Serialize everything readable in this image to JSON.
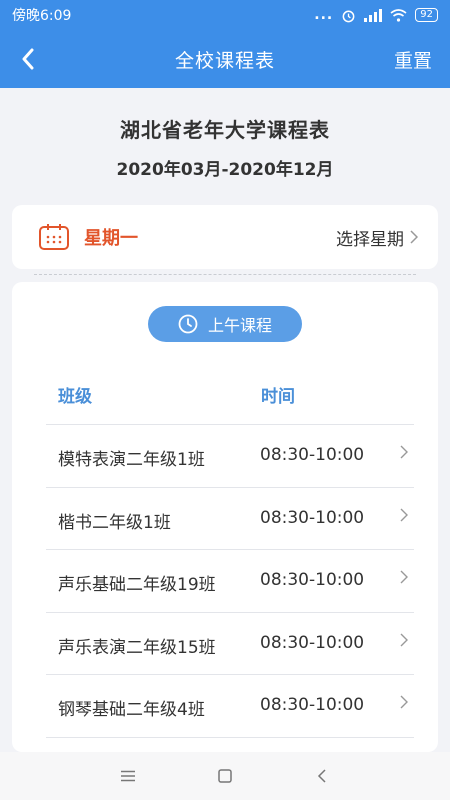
{
  "status_bar": {
    "time": "傍晚6:09",
    "dots": "...",
    "battery": "92"
  },
  "navbar": {
    "title": "全校课程表",
    "reset_label": "重置"
  },
  "header": {
    "school_title": "湖北省老年大学课程表",
    "term": "2020年03月-2020年12月"
  },
  "day_picker": {
    "current_day": "星期一",
    "select_label": "选择星期"
  },
  "session": {
    "label": "上午课程"
  },
  "table": {
    "headers": {
      "class": "班级",
      "time": "时间"
    },
    "rows": [
      {
        "class": "模特表演二年级1班",
        "time": "08:30-10:00"
      },
      {
        "class": "楷书二年级1班",
        "time": "08:30-10:00"
      },
      {
        "class": "声乐基础二年级19班",
        "time": "08:30-10:00"
      },
      {
        "class": "声乐表演二年级15班",
        "time": "08:30-10:00"
      },
      {
        "class": "钢琴基础二年级4班",
        "time": "08:30-10:00"
      }
    ]
  },
  "colors": {
    "primary": "#3d8ee8",
    "accent": "#e2552b",
    "pill": "#5b9ee6",
    "header_text": "#4a8fd8"
  }
}
